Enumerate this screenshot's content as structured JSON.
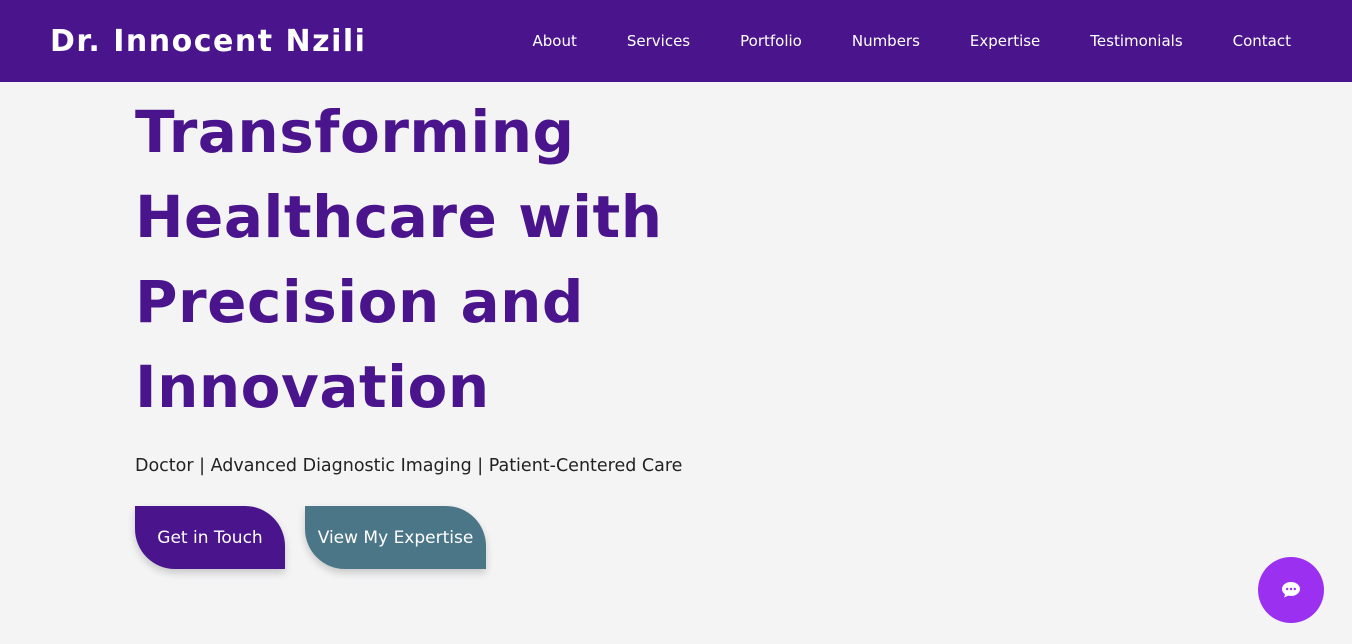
{
  "brand": {
    "name": "Dr. Innocent Nzili"
  },
  "nav": {
    "items": [
      {
        "label": "About"
      },
      {
        "label": "Services"
      },
      {
        "label": "Portfolio"
      },
      {
        "label": "Numbers"
      },
      {
        "label": "Expertise"
      },
      {
        "label": "Testimonials"
      },
      {
        "label": "Contact"
      }
    ]
  },
  "hero": {
    "title_lines": [
      "Transforming",
      "Healthcare with",
      "Precision and",
      "Innovation"
    ],
    "subtitle": "Doctor | Advanced Diagnostic Imaging | Patient-Centered Care",
    "primary_button": "Get in Touch",
    "secondary_button": "View My Expertise"
  },
  "chat": {
    "icon": "chat-bubble-icon"
  },
  "colors": {
    "brand_purple": "#4a148c",
    "secondary_teal": "#4b7687",
    "chat_purple": "#9b30f0",
    "background": "#f4f4f5"
  }
}
